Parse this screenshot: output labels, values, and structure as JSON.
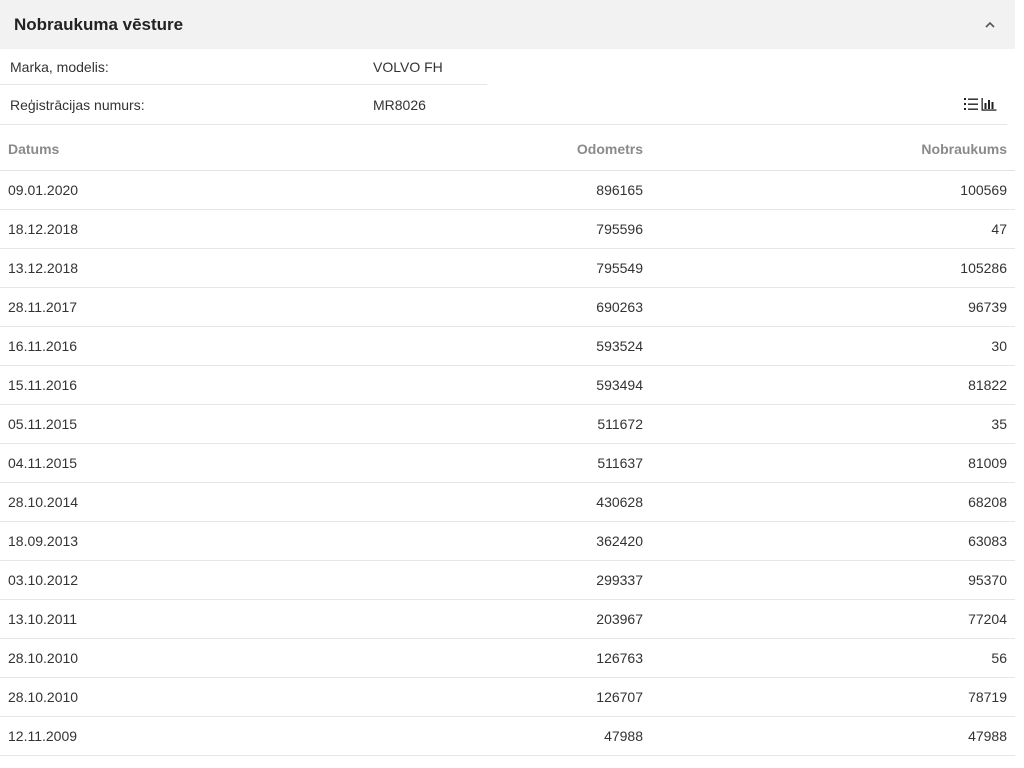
{
  "panel": {
    "title": "Nobraukuma vēsture"
  },
  "vehicle": {
    "make_label": "Marka, modelis:",
    "make_value": "VOLVO FH",
    "reg_label": "Reģistrācijas numurs:",
    "reg_value": "MR8026"
  },
  "icons": {
    "collapse": "chevron-up-icon",
    "list_view": "list-icon",
    "chart_view": "bar-chart-icon"
  },
  "table": {
    "headers": [
      "Datums",
      "Odometrs",
      "Nobraukums"
    ],
    "rows": [
      [
        "09.01.2020",
        "896165",
        "100569"
      ],
      [
        "18.12.2018",
        "795596",
        "47"
      ],
      [
        "13.12.2018",
        "795549",
        "105286"
      ],
      [
        "28.11.2017",
        "690263",
        "96739"
      ],
      [
        "16.11.2016",
        "593524",
        "30"
      ],
      [
        "15.11.2016",
        "593494",
        "81822"
      ],
      [
        "05.11.2015",
        "511672",
        "35"
      ],
      [
        "04.11.2015",
        "511637",
        "81009"
      ],
      [
        "28.10.2014",
        "430628",
        "68208"
      ],
      [
        "18.09.2013",
        "362420",
        "63083"
      ],
      [
        "03.10.2012",
        "299337",
        "95370"
      ],
      [
        "13.10.2011",
        "203967",
        "77204"
      ],
      [
        "28.10.2010",
        "126763",
        "56"
      ],
      [
        "28.10.2010",
        "126707",
        "78719"
      ],
      [
        "12.11.2009",
        "47988",
        "47988"
      ]
    ]
  }
}
